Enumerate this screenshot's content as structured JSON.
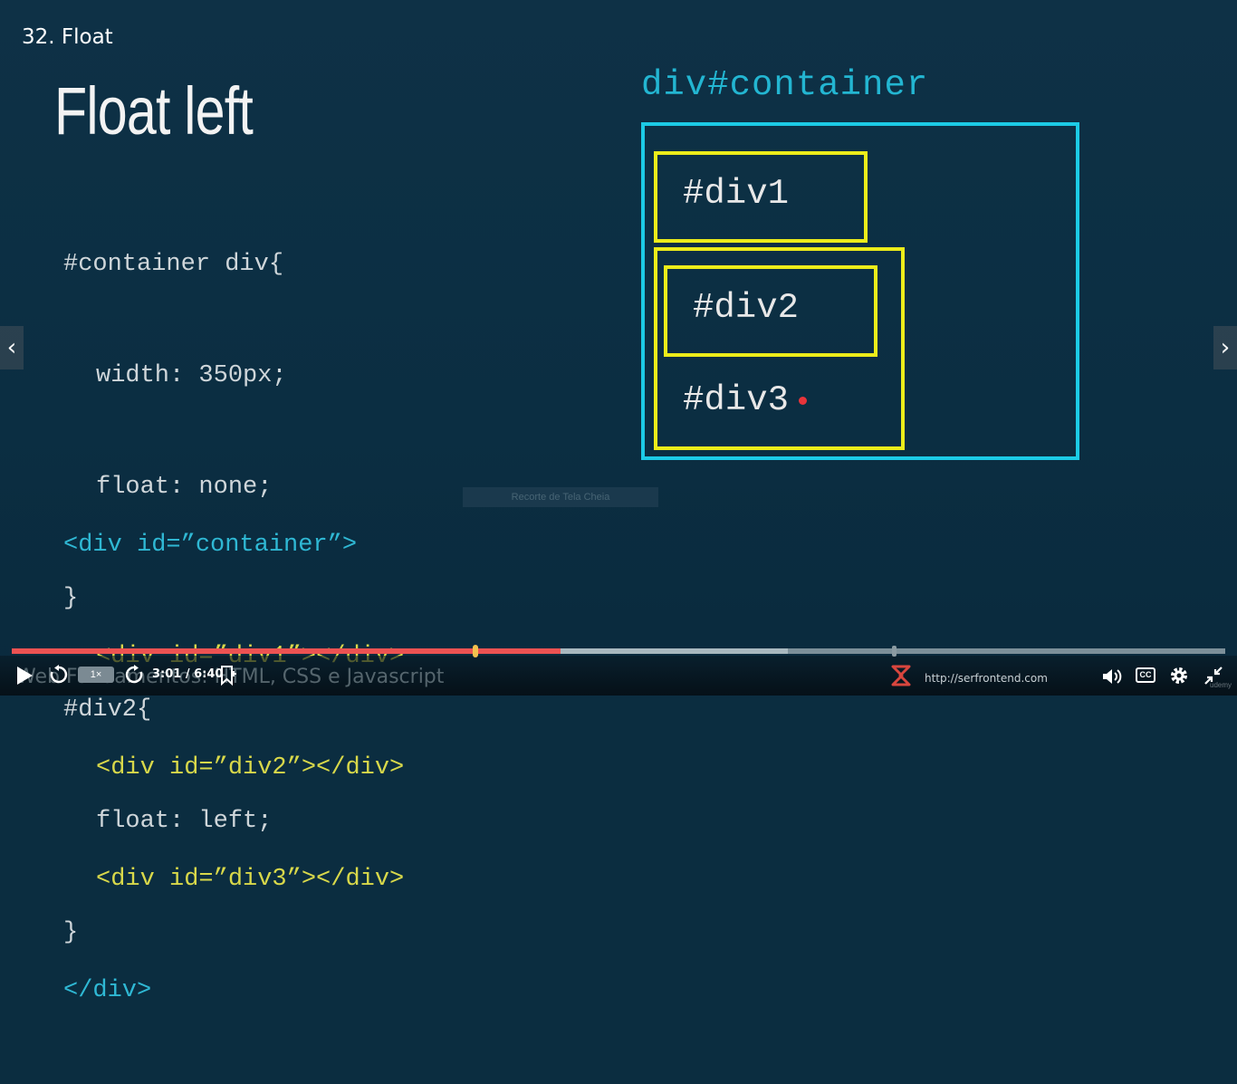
{
  "lecture": {
    "title": "32. Float"
  },
  "slide": {
    "heading": "Float left",
    "css_code": [
      "#container div{",
      "width: 350px;",
      "float: none;",
      "}",
      "#div2{",
      "float: left;",
      "}"
    ],
    "html_code": {
      "open": "<div id=”container”>",
      "children": [
        "<div id=”div1”></div>",
        "<div id=”div2”></div>",
        "<div id=”div3”></div>"
      ],
      "close": "</div>"
    },
    "diagram": {
      "container_label": "div#container",
      "box_labels": [
        "#div1",
        "#div2",
        "#div3"
      ]
    },
    "tooltip": "Recorte de Tela Cheia"
  },
  "player": {
    "speed": "1×",
    "time_current": "3:01",
    "time_total": "6:40",
    "time_display": "3:01 / 6:40",
    "progress_fraction": 0.4525,
    "buffered_fraction": 0.6396,
    "course_watermark": "Web Fundamentos: HTML, CSS e Javascript",
    "site_url": "http://serfrontend.com",
    "cc_label": "CC",
    "udemy_mark": "udemy"
  },
  "colors": {
    "background": "#0b2e42",
    "container_border": "#1ccbe6",
    "div_border": "#ecec1a",
    "progress_played": "#ec5252",
    "progress_thumb": "#f2c14e"
  },
  "icons": [
    "play-icon",
    "rewind-icon",
    "forward-icon",
    "bookmark-icon",
    "logo-icon",
    "volume-icon",
    "cc-icon",
    "gear-icon",
    "exit-fullscreen-icon",
    "chevron-left-icon",
    "chevron-right-icon"
  ]
}
